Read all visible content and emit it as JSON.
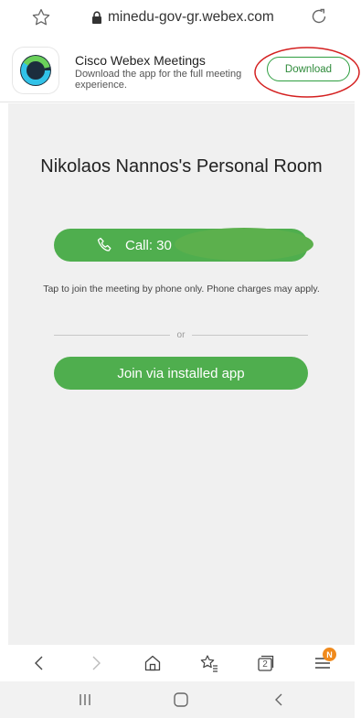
{
  "browser": {
    "url": "minedu-gov-gr.webex.com"
  },
  "banner": {
    "app_name": "Cisco Webex Meetings",
    "app_description": "Download the app for the full meeting experience.",
    "download_label": "Download",
    "accent_color": "#2e9e40"
  },
  "main": {
    "room_title": "Nikolaos Nannos's Personal Room",
    "call_label": "Call: 30",
    "tap_note": "Tap to join the meeting by phone only. Phone charges may apply.",
    "divider_text": "or",
    "join_label": "Join via installed app",
    "button_color": "#4fae4e"
  },
  "toolbar": {
    "tabs_count": "2",
    "badge_text": "N",
    "icons": [
      "back-icon",
      "forward-icon",
      "home-icon",
      "bookmarks-icon",
      "tabs-icon",
      "menu-icon"
    ]
  },
  "navbar": {
    "icons": [
      "recent-apps-icon",
      "home-icon",
      "back-icon"
    ]
  }
}
